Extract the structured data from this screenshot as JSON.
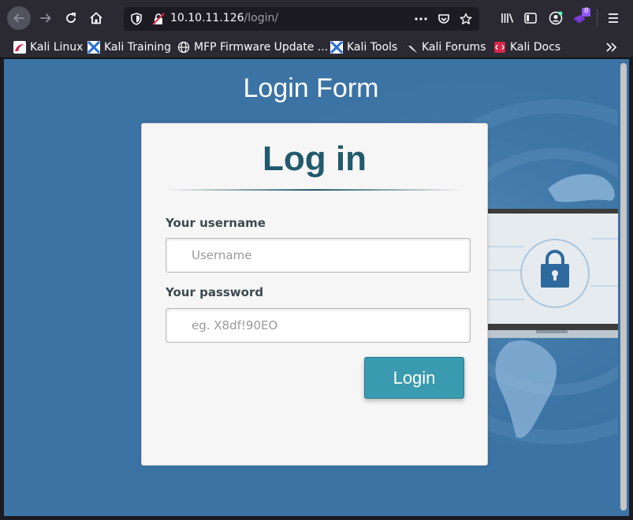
{
  "browser": {
    "url_host": "10.10.11.126",
    "url_path": "/login/",
    "notification_badge": "8",
    "bookmarks": [
      {
        "label": "Kali Linux",
        "icon": "kali-linux-icon"
      },
      {
        "label": "Kali Training",
        "icon": "kali-training-icon"
      },
      {
        "label": "MFP Firmware Update ...",
        "icon": "globe-icon"
      },
      {
        "label": "Kali Tools",
        "icon": "kali-tools-icon"
      },
      {
        "label": "Kali Forums",
        "icon": "kali-forums-icon"
      },
      {
        "label": "Kali Docs",
        "icon": "kali-docs-icon"
      }
    ]
  },
  "page": {
    "title": "Login Form",
    "card_heading": "Log in",
    "username_label": "Your username",
    "username_placeholder": "Username",
    "password_label": "Your password",
    "password_placeholder": "eg. X8df!90EO",
    "login_button": "Login"
  },
  "colors": {
    "page_background": "#3b73a4",
    "heading": "#215a6d",
    "button": "#3a9bb0"
  }
}
